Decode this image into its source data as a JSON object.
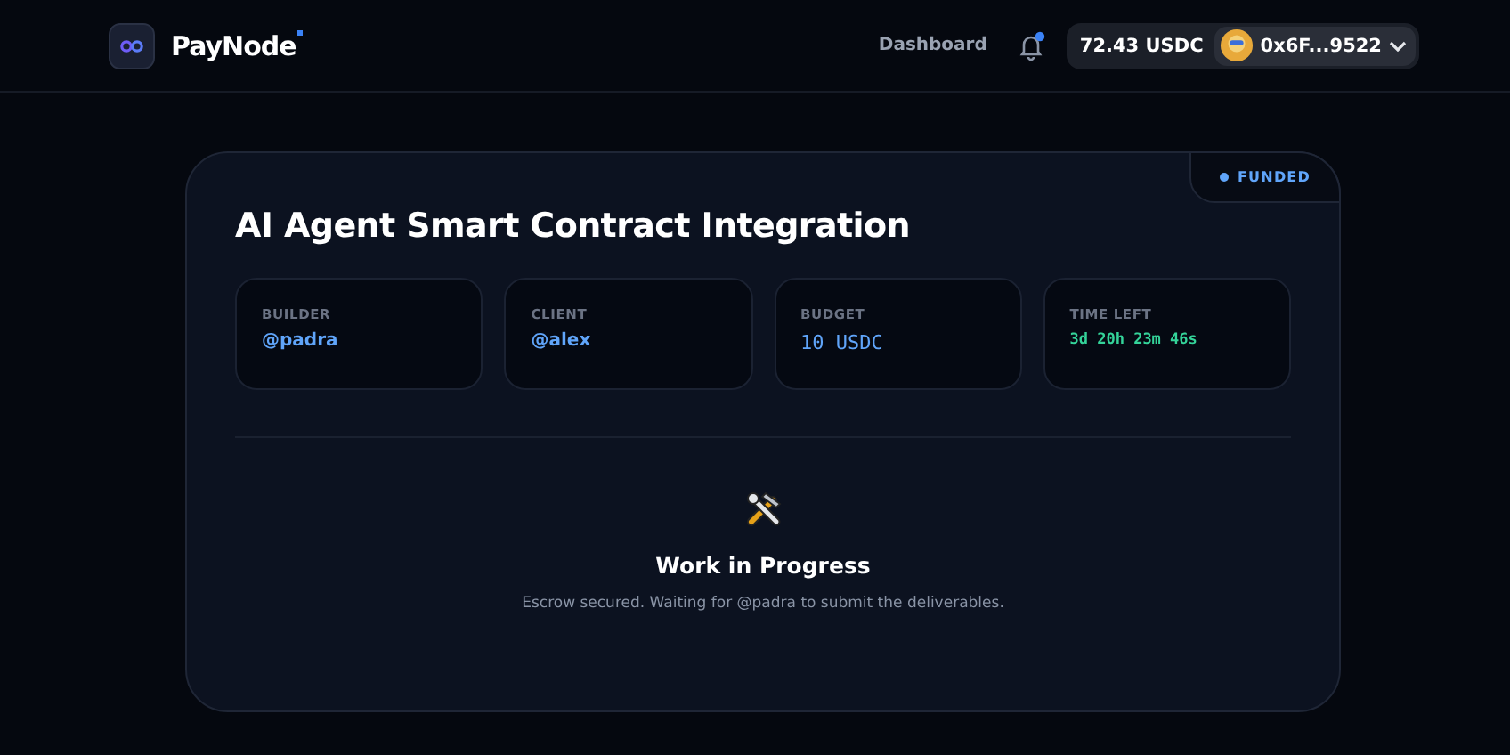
{
  "header": {
    "brand": "PayNode",
    "nav": [
      {
        "label": "Dashboard"
      }
    ],
    "notifications": {
      "unread": true
    },
    "balance": "72.43 USDC",
    "wallet": "0x6F...9522"
  },
  "contract": {
    "status": "FUNDED",
    "title": "AI Agent Smart Contract Integration",
    "stats": [
      {
        "label": "BUILDER",
        "value": "@padra",
        "kind": "handle"
      },
      {
        "label": "CLIENT",
        "value": "@alex",
        "kind": "handle"
      },
      {
        "label": "BUDGET",
        "value": "10 USDC",
        "kind": "amount"
      },
      {
        "label": "TIME LEFT",
        "value": "3d 20h 23m 46s",
        "kind": "timer"
      }
    ],
    "progress": {
      "heading": "Work in Progress",
      "message": "Escrow secured. Waiting for @padra to submit the deliverables."
    }
  }
}
